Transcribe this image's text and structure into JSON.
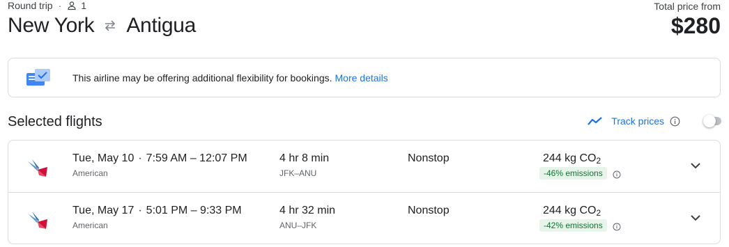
{
  "header": {
    "trip_type": "Round trip",
    "passengers": "1",
    "origin": "New York",
    "destination": "Antigua",
    "price_label": "Total price from",
    "price": "$280"
  },
  "banner": {
    "text": "This airline may be offering additional flexibility for bookings.",
    "link": "More details"
  },
  "section": {
    "title": "Selected flights",
    "track_label": "Track prices"
  },
  "flights": [
    {
      "date": "Tue, May 10",
      "time": "7:59 AM – 12:07 PM",
      "airline": "American",
      "duration": "4 hr 8 min",
      "airports": "JFK–ANU",
      "stops": "Nonstop",
      "co2": "244 kg CO",
      "co2_sub": "2",
      "emissions": "-46% emissions"
    },
    {
      "date": "Tue, May 17",
      "time": "5:01 PM – 9:33 PM",
      "airline": "American",
      "duration": "4 hr 32 min",
      "airports": "ANU–JFK",
      "stops": "Nonstop",
      "co2": "244 kg CO",
      "co2_sub": "2",
      "emissions": "-42% emissions"
    }
  ],
  "colors": {
    "link": "#1a73e8",
    "emissions_bg": "#e6f4ea",
    "emissions_text": "#137333"
  }
}
